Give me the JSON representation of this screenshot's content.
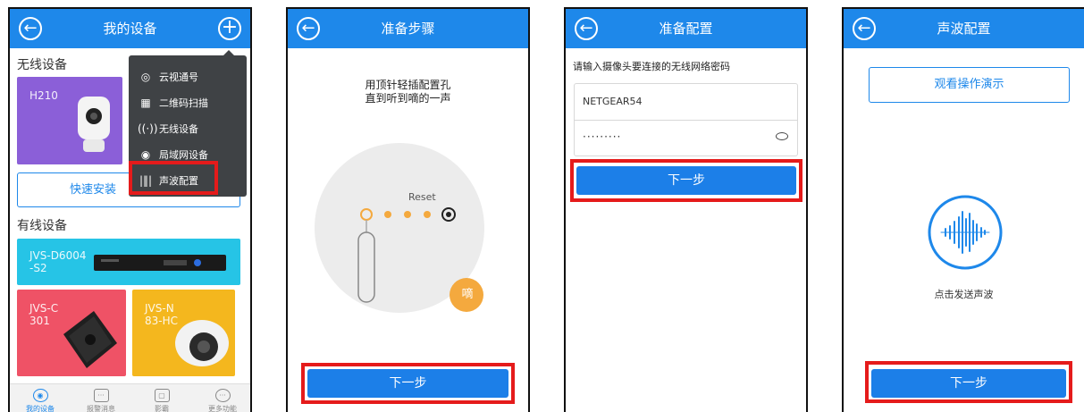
{
  "screen1": {
    "title": "我的设备",
    "back_icon": "back-arrow-icon",
    "add_icon": "plus-icon",
    "wireless_section": "无线设备",
    "wired_section": "有线设备",
    "card_h210": "H210",
    "quick_install": "快速安装",
    "card_d6004": "JVS-D6004\n-S2",
    "card_c301": "JVS-C\n301",
    "card_n83": "JVS-N\n83-HC",
    "popup": [
      {
        "icon": "cloud-camera-icon",
        "label": "云视通号"
      },
      {
        "icon": "qr-code-icon",
        "label": "二维码扫描"
      },
      {
        "icon": "wifi-icon",
        "label": "无线设备"
      },
      {
        "icon": "lan-icon",
        "label": "局域网设备"
      },
      {
        "icon": "sound-wave-icon",
        "label": "声波配置"
      }
    ],
    "tabs": [
      {
        "icon": "camera-tab-icon",
        "label": "我的设备"
      },
      {
        "icon": "message-tab-icon",
        "label": "报警消息"
      },
      {
        "icon": "monitor-tab-icon",
        "label": "影霸"
      },
      {
        "icon": "more-tab-icon",
        "label": "更多功能"
      }
    ]
  },
  "screen2": {
    "title": "准备步骤",
    "instruction_line1": "用顶针轻插配置孔",
    "instruction_line2": "直到听到嘀的一声",
    "reset_label": "Reset",
    "beep_badge": "嘀",
    "next_button": "下一步"
  },
  "screen3": {
    "title": "准备配置",
    "prompt": "请输入摄像头要连接的无线网络密码",
    "ssid_value": "NETGEAR54",
    "password_mask": "·········",
    "next_button": "下一步"
  },
  "screen4": {
    "title": "声波配置",
    "demo_button": "观看操作演示",
    "send_label": "点击发送声波",
    "next_button": "下一步"
  },
  "colors": {
    "bar_blue": "#1e88ea",
    "highlight_red": "#e51b1b",
    "card_purple": "#8b5fd8",
    "card_cyan": "#26c4e6",
    "card_red": "#ef5266",
    "card_yellow": "#f4b71e",
    "beep_orange": "#f4a93e"
  }
}
